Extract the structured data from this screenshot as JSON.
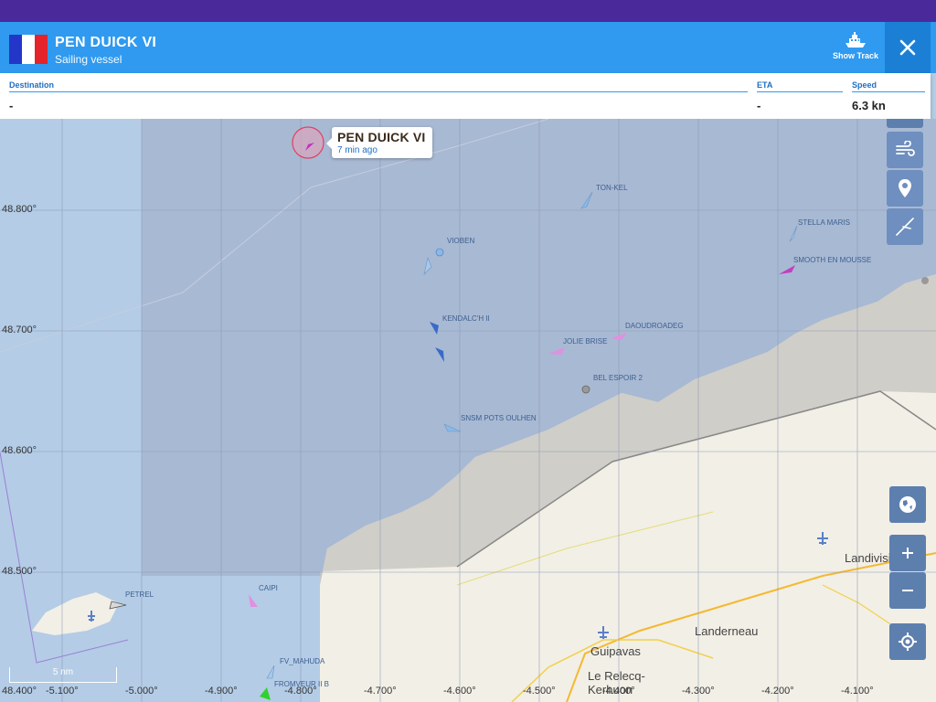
{
  "vessel": {
    "name": "PEN DUICK VI",
    "type": "Sailing vessel",
    "flag_colors": [
      "#2436c8",
      "#ffffff",
      "#e4232b"
    ]
  },
  "header": {
    "show_track_label": "Show Track",
    "ship_icon": "ship-icon",
    "close_icon": "close-icon"
  },
  "info": {
    "destination_label": "Destination",
    "destination_value": "-",
    "eta_label": "ETA",
    "eta_value": "-",
    "speed_label": "Speed",
    "speed_value": "6.3 kn"
  },
  "popup": {
    "name": "PEN DUICK VI",
    "time": "7 min ago"
  },
  "map": {
    "lat_labels": [
      "48.800°",
      "48.700°",
      "48.600°",
      "48.500°"
    ],
    "lon_labels": [
      "48.400°",
      "-5.100°",
      "-5.000°",
      "-4.900°",
      "-4.800°",
      "-4.700°",
      "-4.600°",
      "-4.500°",
      "-4.400°",
      "-4.300°",
      "-4.200°",
      "-4.100°"
    ],
    "vessels": [
      "TON-KEL",
      "VIOBEN",
      "STELLA MARIS",
      "SMOOTH EN MOUSSE",
      "KENDALC'H II",
      "DAOUDROADEG",
      "JOLIE BRISE",
      "BEL ESPOIR 2",
      "SNSM POTS OULHEN",
      "PETREL",
      "CAIPI",
      "FV_MAHUDA",
      "FROMVEUR II B"
    ],
    "towns": [
      "Landivisiau",
      "Landerneau",
      "Guipavas",
      "Le Relecq-Kerhuon"
    ],
    "scale": "5 nm"
  },
  "controls": [
    "layers-icon",
    "wind-icon",
    "location-pin-icon",
    "compass-icon",
    "globe-icon",
    "zoom-in-icon",
    "zoom-out-icon",
    "locate-icon"
  ],
  "colors": {
    "header": "#2f9aef",
    "topbar": "#4a2a9a",
    "sea": "#b4cce6",
    "land": "#f2efe6"
  }
}
